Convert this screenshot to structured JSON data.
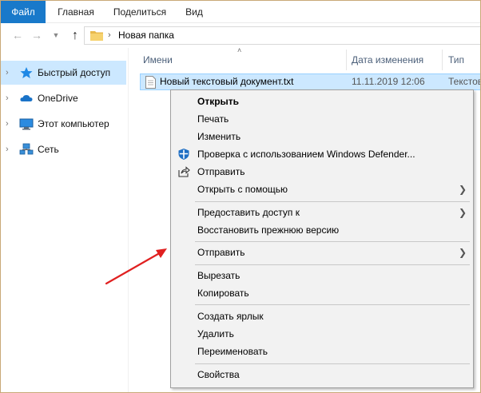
{
  "ribbon": {
    "tabs": [
      "Файл",
      "Главная",
      "Поделиться",
      "Вид"
    ]
  },
  "address": {
    "path_label": "Новая папка"
  },
  "nav": {
    "items": [
      {
        "label": "Быстрый доступ",
        "icon": "star-icon",
        "selected": true
      },
      {
        "label": "OneDrive",
        "icon": "cloud-icon",
        "selected": false
      },
      {
        "label": "Этот компьютер",
        "icon": "computer-icon",
        "selected": false
      },
      {
        "label": "Сеть",
        "icon": "network-icon",
        "selected": false
      }
    ]
  },
  "columns": {
    "name": "Имени",
    "date": "Дата изменения",
    "type": "Тип"
  },
  "file": {
    "name": "Новый текстовый документ.txt",
    "date": "11.11.2019 12:06",
    "type": "Текстовый документ"
  },
  "menu": {
    "items": [
      {
        "label": "Открыть",
        "bold": true
      },
      {
        "label": "Печать"
      },
      {
        "label": "Изменить"
      },
      {
        "label": "Проверка с использованием Windows Defender...",
        "icon": "defender-shield-icon"
      },
      {
        "label": "Отправить",
        "icon": "share-icon"
      },
      {
        "label": "Открыть с помощью",
        "submenu": true
      },
      {
        "label": "Предоставить доступ к",
        "submenu": true
      },
      {
        "label": "Восстановить прежнюю версию"
      },
      {
        "label": "Отправить",
        "submenu": true
      },
      {
        "label": "Вырезать"
      },
      {
        "label": "Копировать"
      },
      {
        "label": "Создать ярлык"
      },
      {
        "label": "Удалить"
      },
      {
        "label": "Переименовать"
      },
      {
        "label": "Свойства"
      }
    ]
  },
  "colors": {
    "accent": "#1979ca",
    "selection": "#cce8ff",
    "annotation": "#e02020"
  }
}
